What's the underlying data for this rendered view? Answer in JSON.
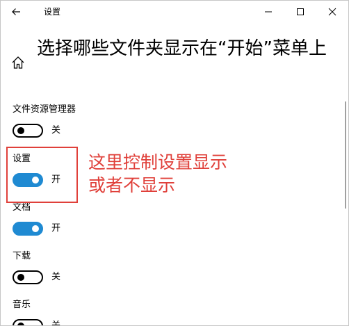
{
  "window": {
    "app_title": "设置",
    "icons": {
      "back": "back-arrow-icon",
      "minimize": "minimize-icon",
      "maximize": "maximize-icon",
      "close": "close-icon",
      "home": "home-icon"
    }
  },
  "page": {
    "title": "选择哪些文件夹显示在“开始”菜单上"
  },
  "settings": [
    {
      "label": "文件资源管理器",
      "state": "关",
      "on": false
    },
    {
      "label": "设置",
      "state": "开",
      "on": true
    },
    {
      "label": "文档",
      "state": "开",
      "on": true
    },
    {
      "label": "下载",
      "state": "关",
      "on": false
    },
    {
      "label": "音乐",
      "state": "关",
      "on": false
    }
  ],
  "annotation": {
    "text": "这里控制设置显示\n或者不显示"
  },
  "colors": {
    "toggle_on": "#1f8ad2",
    "annotation_red": "#e0403a"
  }
}
